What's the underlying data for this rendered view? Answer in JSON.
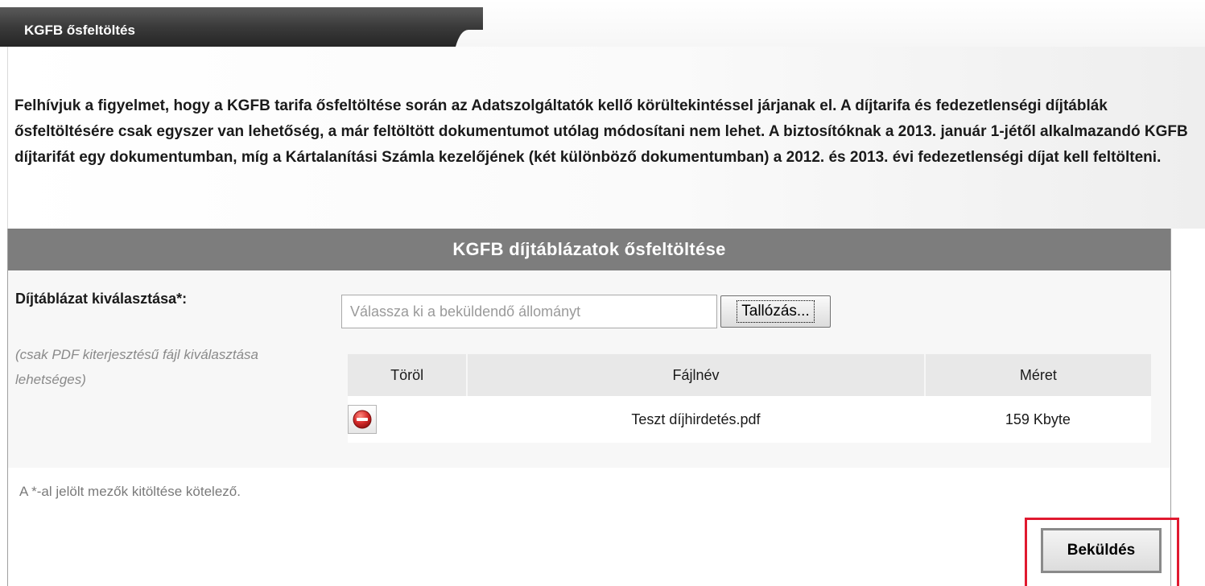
{
  "tab": {
    "title": "KGFB ősfeltöltés"
  },
  "notice": {
    "text": "Felhívjuk a figyelmet, hogy a KGFB tarifa ősfeltöltése során az Adatszolgáltatók kellő körültekintéssel járjanak el. A díjtarifa és fedezetlenségi díjtáblák ősfeltöltésére csak egyszer van lehetőség, a már feltöltött dokumentumot utólag módosítani nem lehet. A biztosítóknak a 2013. január 1-jétől alkalmazandó KGFB díjtarifát egy dokumentumban, míg a Kártalanítási Számla kezelőjének (két különböző dokumentumban) a 2012. és 2013. évi fedezetlenségi díjat kell feltölteni."
  },
  "panel": {
    "title": "KGFB díjtáblázatok ősfeltöltése",
    "field_label": "Díjtáblázat kiválasztása*:",
    "field_hint": "(csak PDF kiterjesztésű fájl kiválasztása lehetséges)",
    "file_input": {
      "placeholder": "Válassza ki a beküldendő állományt",
      "value": ""
    },
    "browse_label": "Tallózás...",
    "table": {
      "headers": {
        "delete": "Töröl",
        "filename": "Fájlnév",
        "size": "Méret"
      },
      "rows": [
        {
          "filename": "Teszt díjhirdetés.pdf",
          "size": "159 Kbyte",
          "delete_icon": "delete-icon"
        }
      ]
    },
    "footer_note": "A *-al jelölt mezők kitöltése kötelező.",
    "submit_label": "Beküldés"
  },
  "colors": {
    "tab_dark": "#2f2f2f",
    "header_gray": "#7d7d7d",
    "delete_red": "#d42a2a",
    "highlight_red": "#e0192f"
  }
}
